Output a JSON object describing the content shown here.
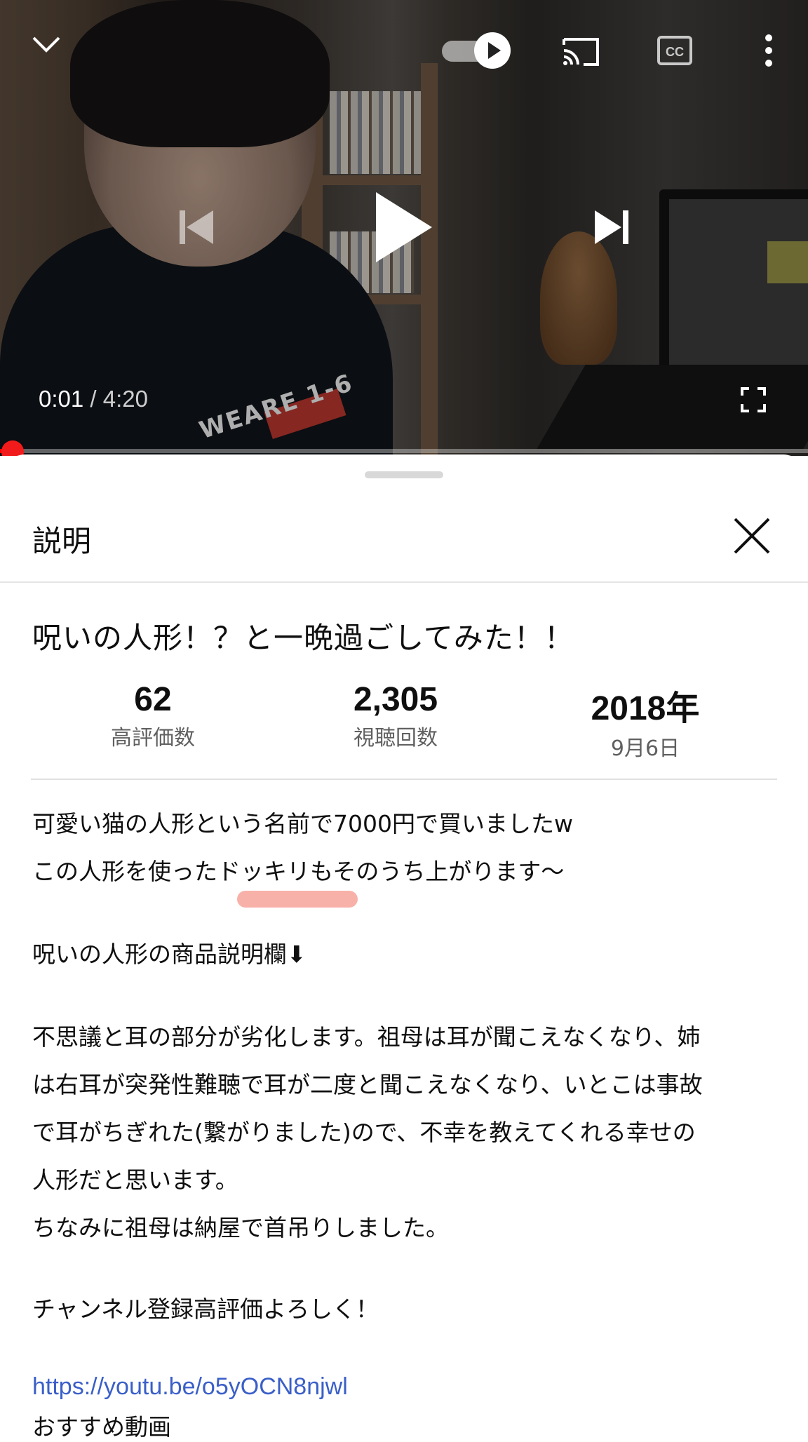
{
  "player": {
    "current_time": "0:01",
    "separator": "/",
    "duration": "4:20",
    "progress_fraction": 0.004,
    "shirt_text": "WEARE 1-6"
  },
  "sheet": {
    "title": "説明",
    "video_title": "呪いの人形！？と一晩過ごしてみた！！",
    "stats": [
      {
        "value": "62",
        "label": "高評価数"
      },
      {
        "value": "2,305",
        "label": "視聴回数"
      },
      {
        "value": "2018年",
        "label": "9月6日"
      }
    ],
    "description": [
      "可愛い猫の人形という名前で7000円で買いましたw",
      "この人形を使ったドッキリもそのうち上がります〜",
      "呪いの人形の商品説明欄⬇",
      "不思議と耳の部分が劣化します。祖母は耳が聞こえなくなり、姉",
      "は右耳が突発性難聴で耳が二度と聞こえなくなり、いとこは事故",
      "で耳がちぎれた(繋がりました)ので、不幸を教えてくれる幸せの",
      "人形だと思います。",
      "ちなみに祖母は納屋で首吊りしました。",
      "チャンネル登録高評価よろしく！"
    ],
    "link": "https://youtu.be/o5yOCN8njwl",
    "recommended_label": "おすすめ動画"
  },
  "colors": {
    "progress_red": "#ff0000",
    "link_blue": "#3a5fc8",
    "highlight_pink": "#f7a39a"
  }
}
